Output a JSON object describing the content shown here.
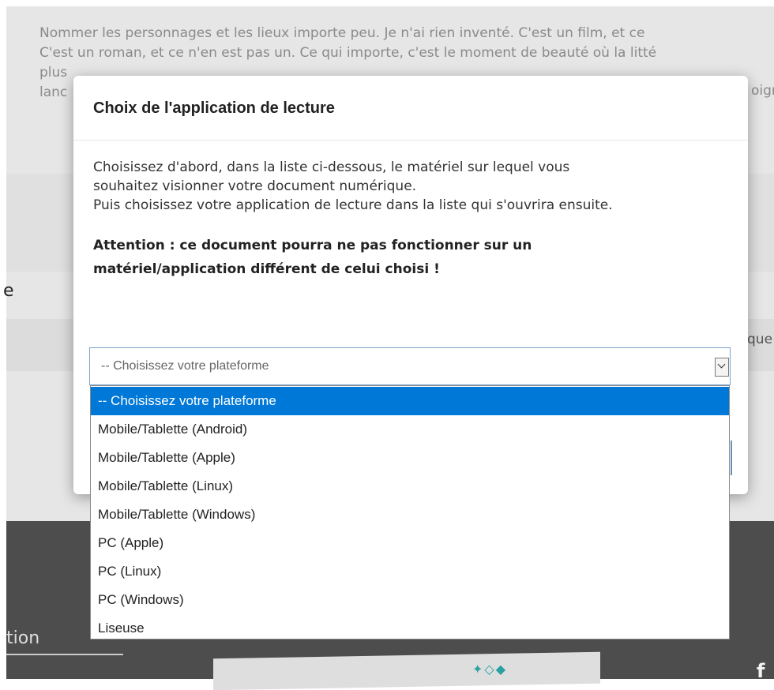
{
  "background": {
    "paragraph_lines": [
      "Nommer les personnages et les lieux importe peu. Je n'ai rien inventé. C'est un film, et ce",
      "C'est un roman, et ce n'en est pas un. Ce qui importe, c'est le moment de beauté où la litté",
      "plus",
      "lanc"
    ],
    "paragraph_right_fragment": "oigr",
    "left_fragment": "e",
    "right_fragment": "que",
    "footer_fragment": "tion",
    "footer_right_fragment": "f"
  },
  "modal": {
    "title": "Choix de l'application de lecture",
    "line1": "Choisissez d'abord, dans la liste ci-dessous, le matériel sur lequel vous",
    "line2": "souhaitez visionner votre document numérique.",
    "line3": "Puis choisissez votre application de lecture dans la liste qui s'ouvrira ensuite.",
    "warning_line1": "Attention : ce document pourra ne pas fonctionner sur un",
    "warning_line2": "matériel/application différent de celui choisi !"
  },
  "platform_select": {
    "value": "-- Choisissez votre plateforme",
    "options": [
      "-- Choisissez votre plateforme",
      "Mobile/Tablette (Android)",
      "Mobile/Tablette (Apple)",
      "Mobile/Tablette (Linux)",
      "Mobile/Tablette (Windows)",
      "PC (Apple)",
      "PC (Linux)",
      "PC (Windows)",
      "Liseuse"
    ],
    "highlighted_index": 0
  }
}
